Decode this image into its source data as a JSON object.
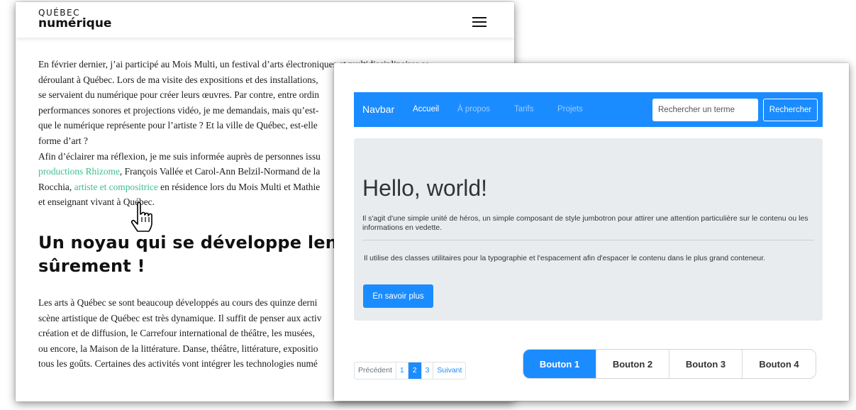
{
  "article_window": {
    "logo": {
      "top": "QUÉBEC",
      "bottom": "numérique"
    },
    "paragraph1_lines": [
      "En février dernier, j’ai participé au Mois Multi, un festival d’arts électroniques et multidisciplinaires se",
      "déroulant à Québec. Lors de ma visite des expositions et des installations,",
      "se servaient du numérique pour créer leurs œuvres. Par contre, entre ordin",
      "performances sonores et projections vidéo, je me demandais, mais qu’est-",
      "que le numérique représente pour l’artiste ? Et la ville de Québec, est-elle",
      "forme d’art ?"
    ],
    "paragraph2": {
      "line1": "Afin d’éclairer ma réflexion, je me suis informée auprès de personnes issu",
      "line2_link": "productions Rhizome",
      "line2_text": ", François Vallée et Carol-Ann Belzil-Normand de la",
      "line3_text_before": "Rocchia, ",
      "line3_link": "artiste et compositrice",
      "line3_text_after": " en résidence lors du Mois Multi et Mathie",
      "line4": "et enseignant vivant à Québec."
    },
    "heading_lines": [
      "Un noyau qui se développe lenteme",
      "sûrement !"
    ],
    "paragraph3_lines": [
      "Les arts à Québec se sont beaucoup développés au cours des quinze derni",
      "scène artistique de Québec est très dynamique. Il suffit de penser aux activ",
      "création et de diffusion, le Carrefour international de théâtre, les musées,",
      "ou encore, la Maison de la littérature. Danse, théâtre, littérature, expositio",
      "tous les goûts. Certaines des activités vont intégrer les technologies numé"
    ]
  },
  "demo_window": {
    "navbar": {
      "brand": "Navbar",
      "links": [
        "Accueil",
        "À propos",
        "Tarifs",
        "Projets"
      ],
      "search_placeholder": "Rechercher un terme",
      "search_button": "Rechercher"
    },
    "jumbotron": {
      "title": "Hello, world!",
      "lead": "Il s'agit d'une simple unité de héros, un simple composant de style jumbotron pour attirer une attention particulière sur le contenu ou les informations en vedette.",
      "info": "Il utilise des classes utilitaires pour la typographie et l'espacement afin d'espacer le contenu dans le plus grand conteneur.",
      "button": "En savoir plus"
    },
    "pagination": {
      "prev": "Précédent",
      "pages": [
        "1",
        "2",
        "3"
      ],
      "active_page": "2",
      "next": "Suivant"
    },
    "button_group": {
      "buttons": [
        "Bouton 1",
        "Bouton 2",
        "Bouton 3",
        "Bouton 4"
      ],
      "active": "Bouton 1"
    },
    "colors": {
      "primary": "#1a8cff",
      "jumbotron_bg": "#e9ecef",
      "link_green": "#3cbf8c"
    }
  }
}
